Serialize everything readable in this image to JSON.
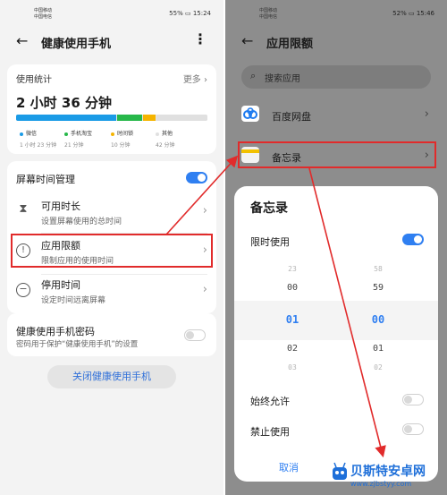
{
  "left": {
    "status": {
      "carrier1": "中国移动",
      "carrier2": "中国电信",
      "battery": "55%",
      "time": "15:24"
    },
    "header": {
      "title": "健康使用手机"
    },
    "usage": {
      "title": "使用统计",
      "more": "更多",
      "total": "2 小时 36 分钟",
      "legend": [
        {
          "name": "微信",
          "value": "1 小时 23 分钟",
          "color": "#1a9be6",
          "fraction": 0.53
        },
        {
          "name": "手机淘宝",
          "value": "21 分钟",
          "color": "#27b84a",
          "fraction": 0.13
        },
        {
          "name": "时间锁",
          "value": "10 分钟",
          "color": "#f5b400",
          "fraction": 0.065
        },
        {
          "name": "其他",
          "value": "42 分钟",
          "color": "#e0e0e0",
          "fraction": 0.27
        }
      ]
    },
    "mgmt": {
      "title": "屏幕时间管理",
      "toggle_on": true,
      "items": [
        {
          "title": "可用时长",
          "sub": "设置屏幕使用的总时间",
          "icon": "hourglass-icon"
        },
        {
          "title": "应用限额",
          "sub": "限制应用的使用时间",
          "icon": "alert-circle-icon"
        },
        {
          "title": "停用时间",
          "sub": "设定时间远离屏幕",
          "icon": "minus-circle-icon"
        }
      ]
    },
    "password": {
      "title": "健康使用手机密码",
      "sub": "密码用于保护“健康使用手机”的设置",
      "toggle_on": false
    },
    "close_button": "关闭健康使用手机"
  },
  "right": {
    "status": {
      "carrier1": "中国移动",
      "carrier2": "中国电信",
      "battery": "52%",
      "time": "15:46"
    },
    "header": {
      "title": "应用限额"
    },
    "search_placeholder": "搜索应用",
    "apps": [
      {
        "name": "百度网盘",
        "icon": "baidu-netdisk-icon"
      },
      {
        "name": "备忘录",
        "icon": "notes-icon"
      }
    ],
    "dialog": {
      "title": "备忘录",
      "limit_label": "限时使用",
      "limit_on": true,
      "hours": [
        "23",
        "00",
        "01",
        "02",
        "03"
      ],
      "minutes": [
        "58",
        "59",
        "00",
        "01",
        "02"
      ],
      "always_allow": "始终允许",
      "forbid": "禁止使用",
      "cancel": "取消"
    }
  },
  "watermark": {
    "name": "贝斯特安卓网",
    "url": "www.zjbstyy.com"
  }
}
